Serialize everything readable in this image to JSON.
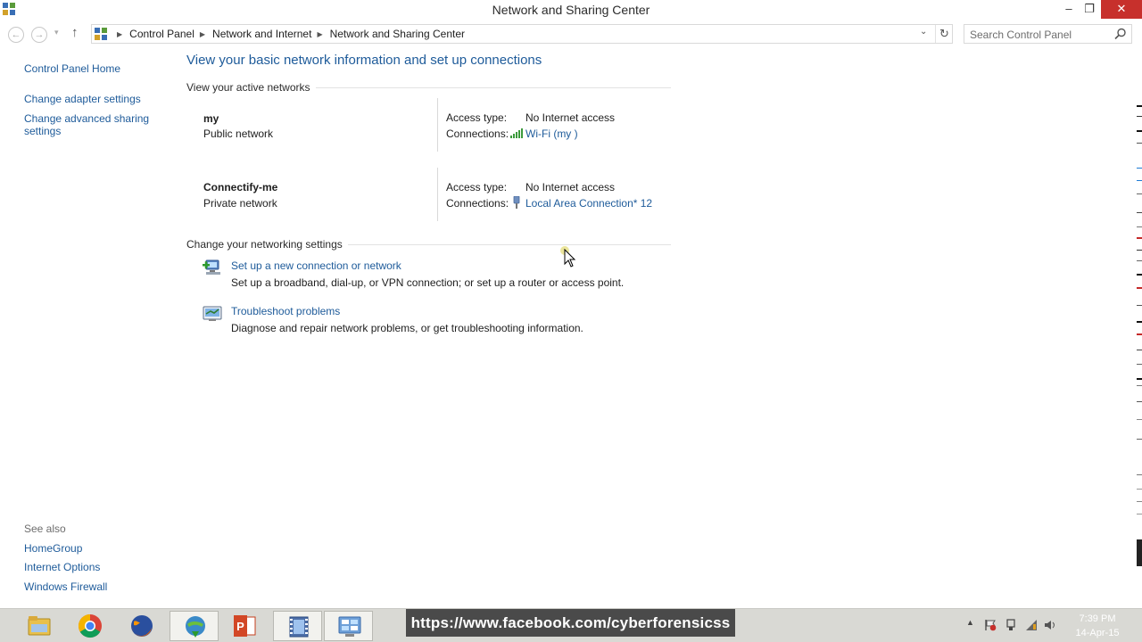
{
  "window": {
    "title": "Network and Sharing Center"
  },
  "window_controls": {
    "minimize": "–",
    "restore": "❐",
    "close": "✕"
  },
  "nav": {
    "back": "←",
    "forward": "→",
    "history": "▾",
    "up": "↑",
    "breadcrumb": [
      "Control Panel",
      "Network and Internet",
      "Network and Sharing Center"
    ],
    "dropdown": "⌄",
    "refresh": "↻"
  },
  "search": {
    "placeholder": "Search Control Panel"
  },
  "sidebar": {
    "home": "Control Panel Home",
    "links": [
      "Change adapter settings",
      "Change advanced sharing settings"
    ],
    "see_also_heading": "See also",
    "see_also": [
      "HomeGroup",
      "Internet Options",
      "Windows Firewall"
    ]
  },
  "main": {
    "heading": "View your basic network information and set up connections",
    "active_section_title": "View your active networks",
    "networks": [
      {
        "name": "my",
        "category": "Public network",
        "access_label": "Access type:",
        "access_value": "No Internet access",
        "conn_label": "Connections:",
        "conn_value": "Wi-Fi (my )",
        "conn_icon": "wifi-signal-icon"
      },
      {
        "name": "Connectify-me",
        "category": "Private network",
        "access_label": "Access type:",
        "access_value": "No Internet access",
        "conn_label": "Connections:",
        "conn_value": "Local Area Connection* 12",
        "conn_icon": "ethernet-plug-icon"
      }
    ],
    "settings_section_title": "Change your networking settings",
    "tasks": [
      {
        "link": "Set up a new connection or network",
        "desc": "Set up a broadband, dial-up, or VPN connection; or set up a router or access point.",
        "icon": "new-connection-icon"
      },
      {
        "link": "Troubleshoot problems",
        "desc": "Diagnose and repair network problems, or get troubleshooting information.",
        "icon": "troubleshoot-icon"
      }
    ]
  },
  "taskbar": {
    "apps": [
      "file-explorer-icon",
      "chrome-icon",
      "firefox-icon",
      "internet-download-manager-icon",
      "powerpoint-icon",
      "video-editor-icon",
      "control-panel-icon"
    ],
    "overlay_banner": "https://www.facebook.com/cyberforensicss",
    "tray_arrow": "▲",
    "clock_time": "7:39 PM",
    "clock_date": "14-Apr-15"
  },
  "colors": {
    "link": "#1e5b9a",
    "close_button": "#c7302c",
    "taskbar": "#d9d9d4"
  }
}
